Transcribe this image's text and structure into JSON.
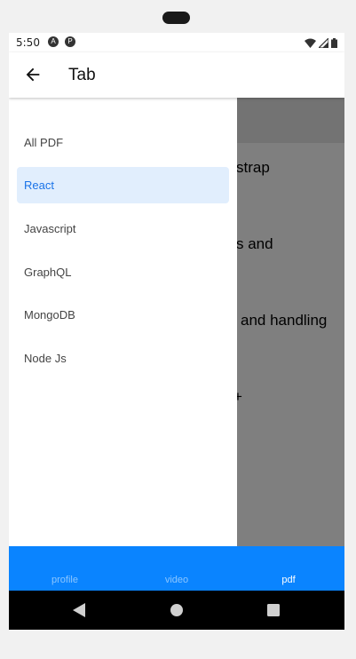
{
  "status_bar": {
    "time": "5:50",
    "notif1": "A",
    "notif2": "P"
  },
  "app_bar": {
    "title": "Tab"
  },
  "content": {
    "items": [
      "strap",
      "s and",
      "and handling",
      "+"
    ]
  },
  "drawer": {
    "items": [
      {
        "label": "All PDF"
      },
      {
        "label": "React"
      },
      {
        "label": "Javascript"
      },
      {
        "label": "GraphQL"
      },
      {
        "label": "MongoDB"
      },
      {
        "label": "Node Js"
      }
    ],
    "active_index": 1,
    "active_color": "#1a73e8",
    "active_bg": "#e1eefd"
  },
  "tab_bar": {
    "tabs": [
      {
        "label": "profile"
      },
      {
        "label": "video"
      },
      {
        "label": "pdf"
      }
    ],
    "active_index": 2,
    "color": "#0a84ff"
  },
  "icons": {
    "back": "arrow-left-icon",
    "wifi": "wifi-icon",
    "signal": "signal-icon",
    "battery": "battery-icon",
    "nav_back": "triangle-back-icon",
    "nav_home": "circle-home-icon",
    "nav_recents": "square-recents-icon"
  }
}
